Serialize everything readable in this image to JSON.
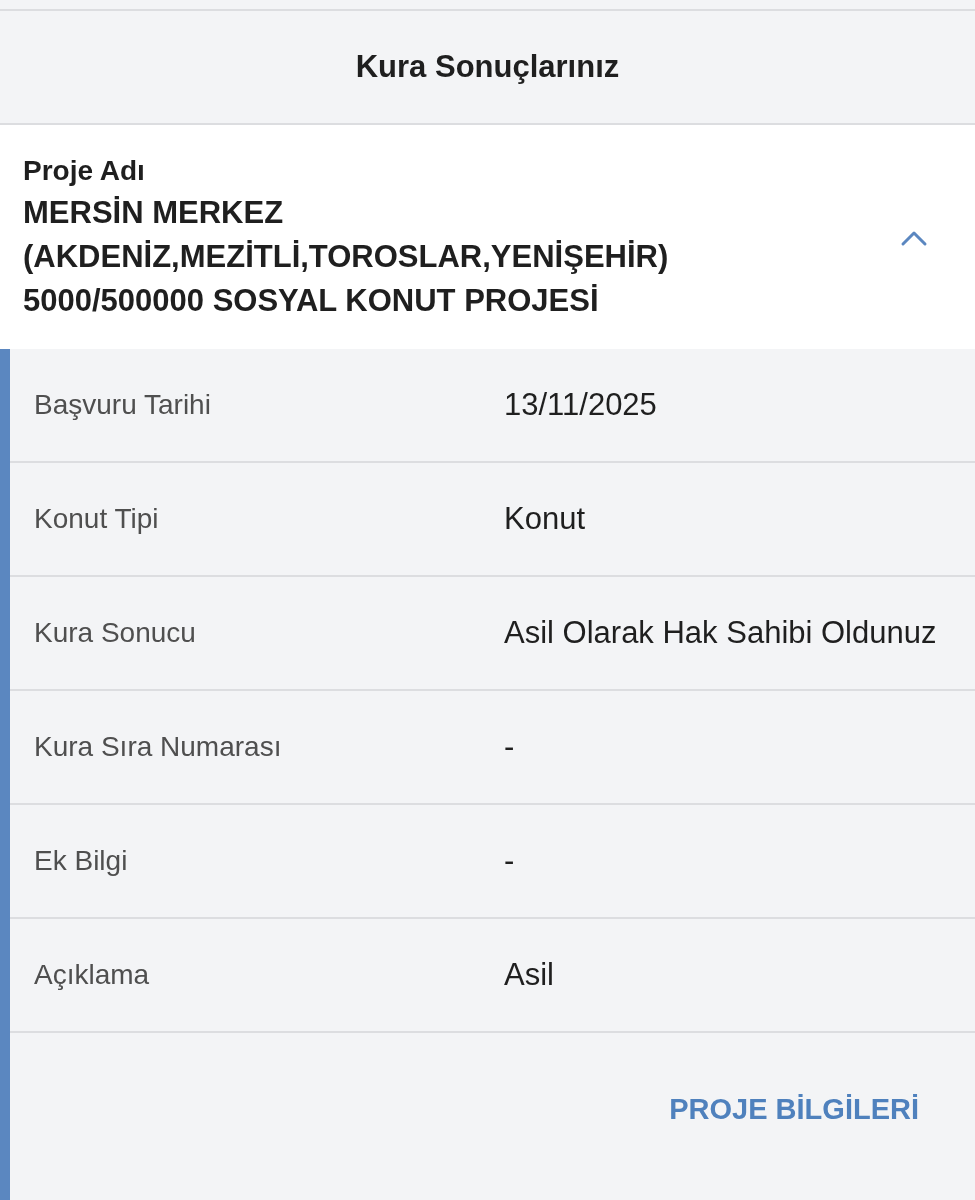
{
  "header": {
    "title": "Kura Sonuçlarınız"
  },
  "project": {
    "label": "Proje Adı",
    "name_lines": [
      "MERSİN MERKEZ",
      "(AKDENİZ,MEZİTLİ,TOROSLAR,YENİŞEHİR)",
      "5000/500000 SOSYAL KONUT PROJESİ"
    ],
    "expanded": true
  },
  "details": [
    {
      "label": "Başvuru Tarihi",
      "value": "13/11/2025"
    },
    {
      "label": "Konut Tipi",
      "value": "Konut"
    },
    {
      "label": "Kura Sonucu",
      "value": "Asil Olarak Hak Sahibi Oldunuz"
    },
    {
      "label": "Kura Sıra Numarası",
      "value": "-"
    },
    {
      "label": "Ek Bilgi",
      "value": "-"
    },
    {
      "label": "Açıklama",
      "value": "Asil"
    }
  ],
  "action_button": "PROJE BİLGİLERİ"
}
